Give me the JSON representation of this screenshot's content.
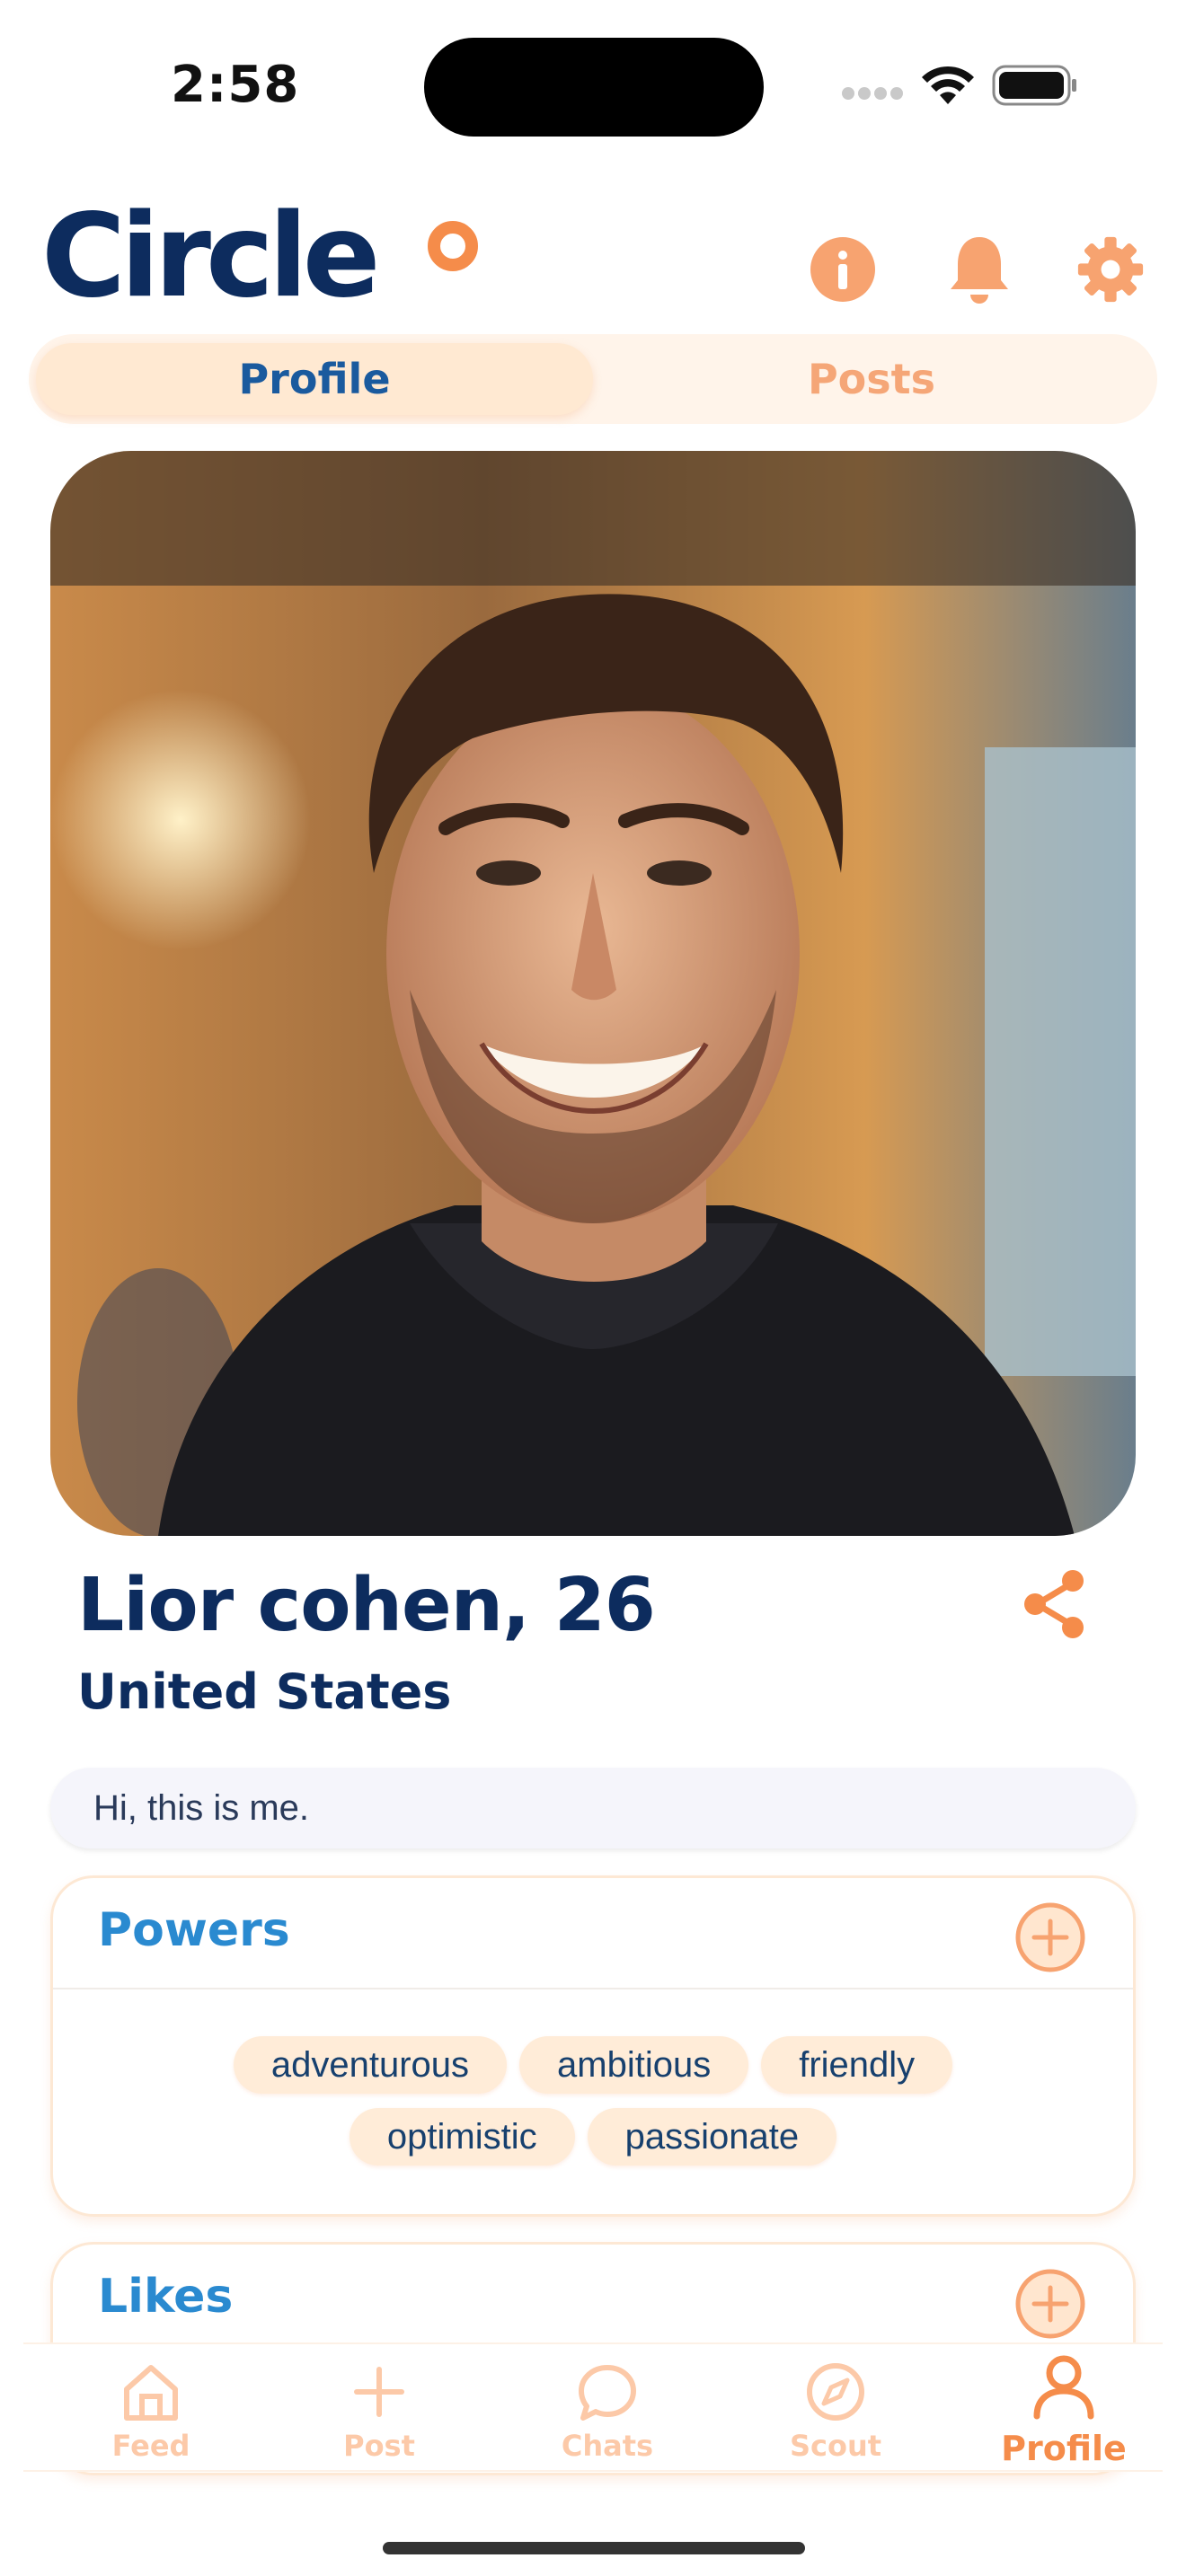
{
  "status_bar": {
    "time": "2:58"
  },
  "header": {
    "logo": "Circle"
  },
  "tabs": [
    {
      "label": "Profile",
      "active": true
    },
    {
      "label": "Posts",
      "active": false
    }
  ],
  "profile": {
    "name": "Lior cohen, 26",
    "location": "United States",
    "bio": "Hi, this is me."
  },
  "powers": {
    "title": "Powers",
    "chips": [
      "adventurous",
      "ambitious",
      "friendly",
      "optimistic",
      "passionate"
    ]
  },
  "likes": {
    "title": "Likes"
  },
  "bottom_nav": [
    {
      "label": "Feed",
      "icon": "home-icon",
      "active": false
    },
    {
      "label": "Post",
      "icon": "plus-icon",
      "active": false
    },
    {
      "label": "Chats",
      "icon": "chat-bubble-icon",
      "active": false
    },
    {
      "label": "Scout",
      "icon": "compass-icon",
      "active": false
    },
    {
      "label": "Profile",
      "icon": "person-icon",
      "active": true
    }
  ],
  "colors": {
    "brand_navy": "#0d2c5e",
    "accent_orange": "#f58c4a",
    "title_blue": "#2a8ad0"
  }
}
